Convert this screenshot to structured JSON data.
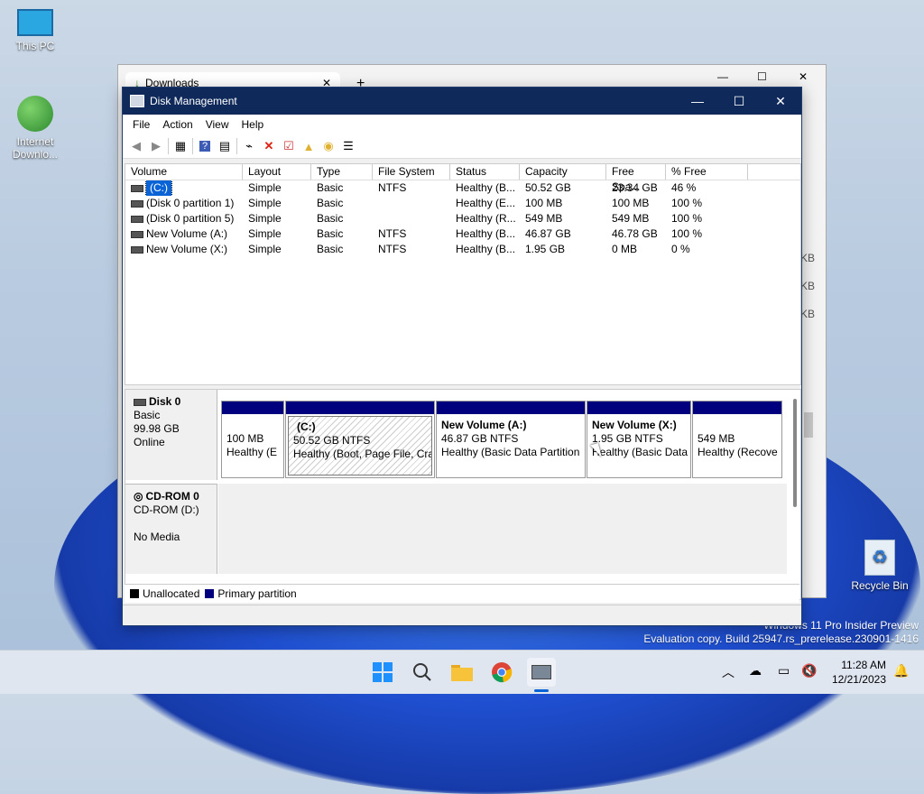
{
  "desktop": {
    "icons": [
      {
        "label": "This PC"
      },
      {
        "label": "Internet Downlo..."
      },
      {
        "label": "Recycle Bin"
      }
    ],
    "watermark_line1": "Windows 11 Pro Insider Preview",
    "watermark_line2": "Evaluation copy. Build 25947.rs_prerelease.230901-1416"
  },
  "bg_window": {
    "tab_title": "Downloads",
    "side_items": [
      "KB",
      "KB",
      "KB"
    ]
  },
  "window": {
    "title": "Disk Management",
    "menu": [
      "File",
      "Action",
      "View",
      "Help"
    ],
    "toolbar": [
      "back-icon",
      "forward-icon",
      "properties-icon",
      "help-icon",
      "view-icon",
      "connect-icon",
      "delete-icon",
      "check-icon",
      "folder-up-icon",
      "folder-search-icon",
      "list-icon"
    ]
  },
  "volumes": {
    "columns": [
      "Volume",
      "Layout",
      "Type",
      "File System",
      "Status",
      "Capacity",
      "Free Spa...",
      "% Free"
    ],
    "rows": [
      [
        "(C:)",
        "Simple",
        "Basic",
        "NTFS",
        "Healthy (B...",
        "50.52 GB",
        "23.34 GB",
        "46 %"
      ],
      [
        "(Disk 0 partition 1)",
        "Simple",
        "Basic",
        "",
        "Healthy (E...",
        "100 MB",
        "100 MB",
        "100 %"
      ],
      [
        "(Disk 0 partition 5)",
        "Simple",
        "Basic",
        "",
        "Healthy (R...",
        "549 MB",
        "549 MB",
        "100 %"
      ],
      [
        "New Volume (A:)",
        "Simple",
        "Basic",
        "NTFS",
        "Healthy (B...",
        "46.87 GB",
        "46.78 GB",
        "100 %"
      ],
      [
        "New Volume (X:)",
        "Simple",
        "Basic",
        "NTFS",
        "Healthy (B...",
        "1.95 GB",
        "0 MB",
        "0 %"
      ]
    ]
  },
  "disks": [
    {
      "name": "Disk 0",
      "type": "Basic",
      "size": "99.98 GB",
      "state": "Online",
      "partitions": [
        {
          "title": "",
          "size": "100 MB",
          "status": "Healthy (E"
        },
        {
          "title": "(C:)",
          "size": "50.52 GB NTFS",
          "status": "Healthy (Boot, Page File, Cras"
        },
        {
          "title": "New Volume  (A:)",
          "size": "46.87 GB NTFS",
          "status": "Healthy (Basic Data Partition"
        },
        {
          "title": "New Volume  (X:)",
          "size": "1.95 GB NTFS",
          "status": "Healthy (Basic Data"
        },
        {
          "title": "",
          "size": "549 MB",
          "status": "Healthy (Recove"
        }
      ]
    },
    {
      "name": "CD-ROM 0",
      "type": "CD-ROM (D:)",
      "size": "",
      "state": "No Media"
    }
  ],
  "legend": [
    "Unallocated",
    "Primary partition"
  ],
  "colors": {
    "unallocated": "#000000",
    "primary": "#00007e",
    "titlebar": "#0f2a5a"
  },
  "taskbar": {
    "time": "11:28 AM",
    "date": "12/21/2023"
  }
}
